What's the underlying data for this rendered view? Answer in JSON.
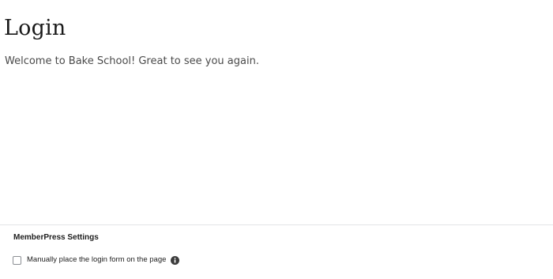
{
  "page": {
    "title": "Login",
    "intro": "Welcome to Bake School! Great to see you again."
  },
  "settings_panel": {
    "heading": "MemberPress Settings",
    "manual_login_option": {
      "label": "Manually place the login form on the page",
      "checked": false,
      "icon": "info-icon"
    }
  }
}
